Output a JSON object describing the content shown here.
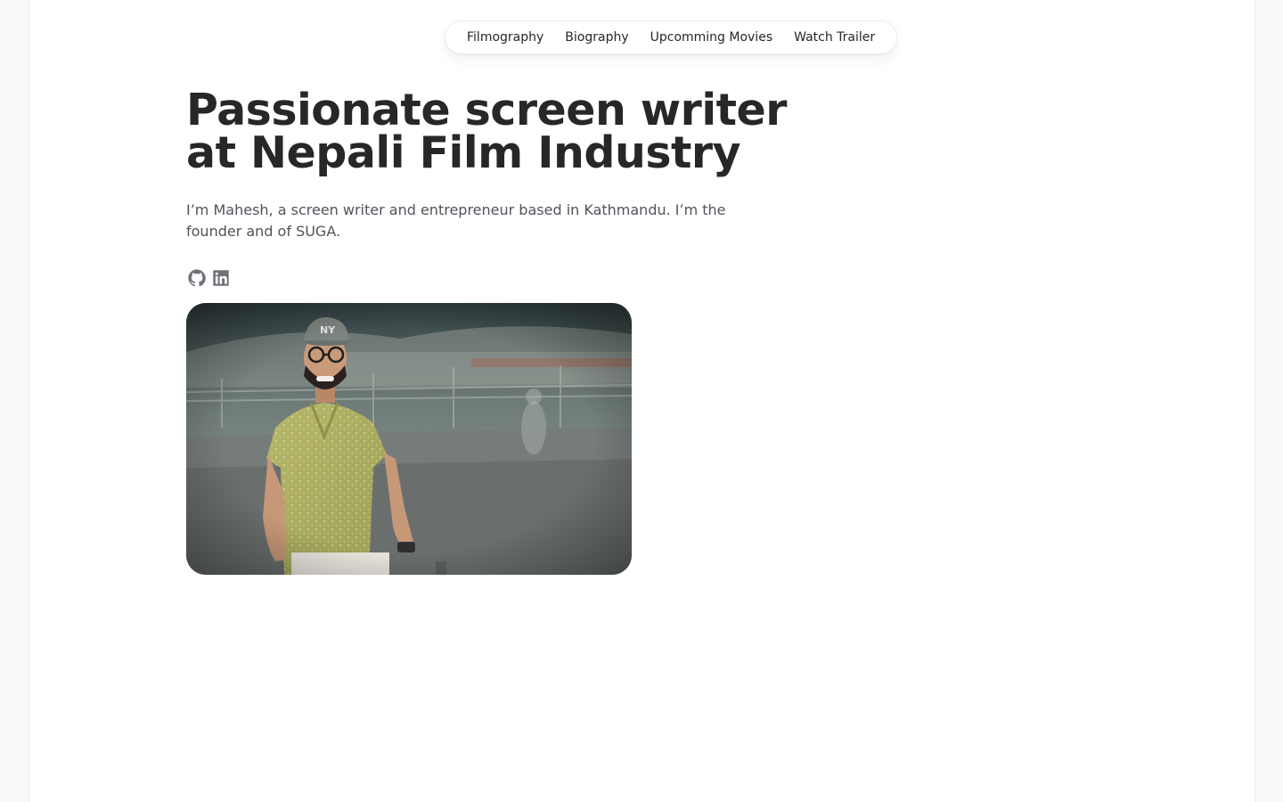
{
  "nav": {
    "items": [
      {
        "label": "Filmography"
      },
      {
        "label": "Biography"
      },
      {
        "label": "Upcomming Movies"
      },
      {
        "label": "Watch Trailer"
      }
    ]
  },
  "hero": {
    "title_line1": "Passionate screen writer",
    "title_line2": "at Nepali Film Industry",
    "intro": "I’m Mahesh, a screen writer and entrepreneur based in Kathmandu. I’m the founder and of SUGA."
  },
  "social": {
    "links": [
      {
        "icon": "github-icon"
      },
      {
        "icon": "linkedin-icon"
      }
    ]
  },
  "colors": {
    "heading": "#27272a",
    "body_text": "#52525b",
    "icon": "#71717a",
    "background": "#fafafa",
    "card": "#ffffff"
  }
}
